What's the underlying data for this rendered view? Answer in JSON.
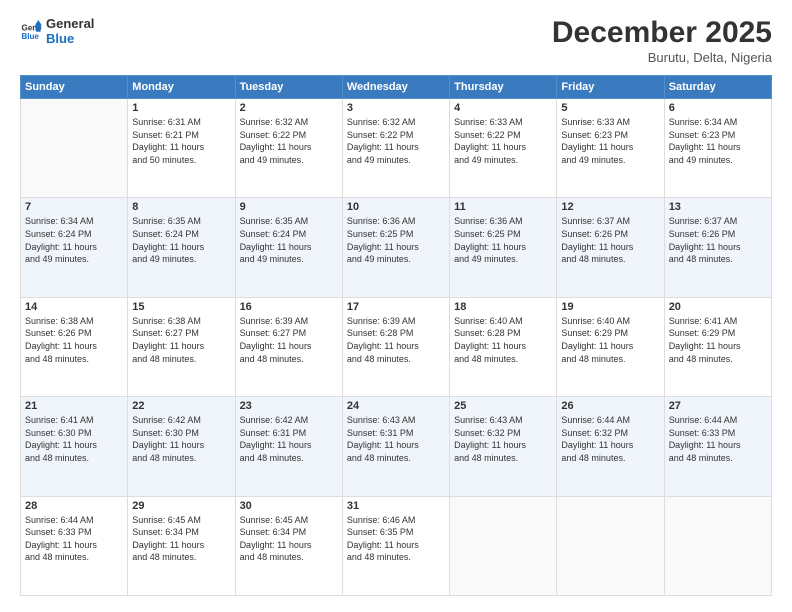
{
  "header": {
    "logo_line1": "General",
    "logo_line2": "Blue",
    "month_title": "December 2025",
    "location": "Burutu, Delta, Nigeria"
  },
  "weekdays": [
    "Sunday",
    "Monday",
    "Tuesday",
    "Wednesday",
    "Thursday",
    "Friday",
    "Saturday"
  ],
  "weeks": [
    [
      {
        "day": "",
        "sunrise": "",
        "sunset": "",
        "daylight": ""
      },
      {
        "day": "1",
        "sunrise": "Sunrise: 6:31 AM",
        "sunset": "Sunset: 6:21 PM",
        "daylight": "Daylight: 11 hours and 50 minutes."
      },
      {
        "day": "2",
        "sunrise": "Sunrise: 6:32 AM",
        "sunset": "Sunset: 6:22 PM",
        "daylight": "Daylight: 11 hours and 49 minutes."
      },
      {
        "day": "3",
        "sunrise": "Sunrise: 6:32 AM",
        "sunset": "Sunset: 6:22 PM",
        "daylight": "Daylight: 11 hours and 49 minutes."
      },
      {
        "day": "4",
        "sunrise": "Sunrise: 6:33 AM",
        "sunset": "Sunset: 6:22 PM",
        "daylight": "Daylight: 11 hours and 49 minutes."
      },
      {
        "day": "5",
        "sunrise": "Sunrise: 6:33 AM",
        "sunset": "Sunset: 6:23 PM",
        "daylight": "Daylight: 11 hours and 49 minutes."
      },
      {
        "day": "6",
        "sunrise": "Sunrise: 6:34 AM",
        "sunset": "Sunset: 6:23 PM",
        "daylight": "Daylight: 11 hours and 49 minutes."
      }
    ],
    [
      {
        "day": "7",
        "sunrise": "Sunrise: 6:34 AM",
        "sunset": "Sunset: 6:24 PM",
        "daylight": "Daylight: 11 hours and 49 minutes."
      },
      {
        "day": "8",
        "sunrise": "Sunrise: 6:35 AM",
        "sunset": "Sunset: 6:24 PM",
        "daylight": "Daylight: 11 hours and 49 minutes."
      },
      {
        "day": "9",
        "sunrise": "Sunrise: 6:35 AM",
        "sunset": "Sunset: 6:24 PM",
        "daylight": "Daylight: 11 hours and 49 minutes."
      },
      {
        "day": "10",
        "sunrise": "Sunrise: 6:36 AM",
        "sunset": "Sunset: 6:25 PM",
        "daylight": "Daylight: 11 hours and 49 minutes."
      },
      {
        "day": "11",
        "sunrise": "Sunrise: 6:36 AM",
        "sunset": "Sunset: 6:25 PM",
        "daylight": "Daylight: 11 hours and 49 minutes."
      },
      {
        "day": "12",
        "sunrise": "Sunrise: 6:37 AM",
        "sunset": "Sunset: 6:26 PM",
        "daylight": "Daylight: 11 hours and 48 minutes."
      },
      {
        "day": "13",
        "sunrise": "Sunrise: 6:37 AM",
        "sunset": "Sunset: 6:26 PM",
        "daylight": "Daylight: 11 hours and 48 minutes."
      }
    ],
    [
      {
        "day": "14",
        "sunrise": "Sunrise: 6:38 AM",
        "sunset": "Sunset: 6:26 PM",
        "daylight": "Daylight: 11 hours and 48 minutes."
      },
      {
        "day": "15",
        "sunrise": "Sunrise: 6:38 AM",
        "sunset": "Sunset: 6:27 PM",
        "daylight": "Daylight: 11 hours and 48 minutes."
      },
      {
        "day": "16",
        "sunrise": "Sunrise: 6:39 AM",
        "sunset": "Sunset: 6:27 PM",
        "daylight": "Daylight: 11 hours and 48 minutes."
      },
      {
        "day": "17",
        "sunrise": "Sunrise: 6:39 AM",
        "sunset": "Sunset: 6:28 PM",
        "daylight": "Daylight: 11 hours and 48 minutes."
      },
      {
        "day": "18",
        "sunrise": "Sunrise: 6:40 AM",
        "sunset": "Sunset: 6:28 PM",
        "daylight": "Daylight: 11 hours and 48 minutes."
      },
      {
        "day": "19",
        "sunrise": "Sunrise: 6:40 AM",
        "sunset": "Sunset: 6:29 PM",
        "daylight": "Daylight: 11 hours and 48 minutes."
      },
      {
        "day": "20",
        "sunrise": "Sunrise: 6:41 AM",
        "sunset": "Sunset: 6:29 PM",
        "daylight": "Daylight: 11 hours and 48 minutes."
      }
    ],
    [
      {
        "day": "21",
        "sunrise": "Sunrise: 6:41 AM",
        "sunset": "Sunset: 6:30 PM",
        "daylight": "Daylight: 11 hours and 48 minutes."
      },
      {
        "day": "22",
        "sunrise": "Sunrise: 6:42 AM",
        "sunset": "Sunset: 6:30 PM",
        "daylight": "Daylight: 11 hours and 48 minutes."
      },
      {
        "day": "23",
        "sunrise": "Sunrise: 6:42 AM",
        "sunset": "Sunset: 6:31 PM",
        "daylight": "Daylight: 11 hours and 48 minutes."
      },
      {
        "day": "24",
        "sunrise": "Sunrise: 6:43 AM",
        "sunset": "Sunset: 6:31 PM",
        "daylight": "Daylight: 11 hours and 48 minutes."
      },
      {
        "day": "25",
        "sunrise": "Sunrise: 6:43 AM",
        "sunset": "Sunset: 6:32 PM",
        "daylight": "Daylight: 11 hours and 48 minutes."
      },
      {
        "day": "26",
        "sunrise": "Sunrise: 6:44 AM",
        "sunset": "Sunset: 6:32 PM",
        "daylight": "Daylight: 11 hours and 48 minutes."
      },
      {
        "day": "27",
        "sunrise": "Sunrise: 6:44 AM",
        "sunset": "Sunset: 6:33 PM",
        "daylight": "Daylight: 11 hours and 48 minutes."
      }
    ],
    [
      {
        "day": "28",
        "sunrise": "Sunrise: 6:44 AM",
        "sunset": "Sunset: 6:33 PM",
        "daylight": "Daylight: 11 hours and 48 minutes."
      },
      {
        "day": "29",
        "sunrise": "Sunrise: 6:45 AM",
        "sunset": "Sunset: 6:34 PM",
        "daylight": "Daylight: 11 hours and 48 minutes."
      },
      {
        "day": "30",
        "sunrise": "Sunrise: 6:45 AM",
        "sunset": "Sunset: 6:34 PM",
        "daylight": "Daylight: 11 hours and 48 minutes."
      },
      {
        "day": "31",
        "sunrise": "Sunrise: 6:46 AM",
        "sunset": "Sunset: 6:35 PM",
        "daylight": "Daylight: 11 hours and 48 minutes."
      },
      {
        "day": "",
        "sunrise": "",
        "sunset": "",
        "daylight": ""
      },
      {
        "day": "",
        "sunrise": "",
        "sunset": "",
        "daylight": ""
      },
      {
        "day": "",
        "sunrise": "",
        "sunset": "",
        "daylight": ""
      }
    ]
  ]
}
